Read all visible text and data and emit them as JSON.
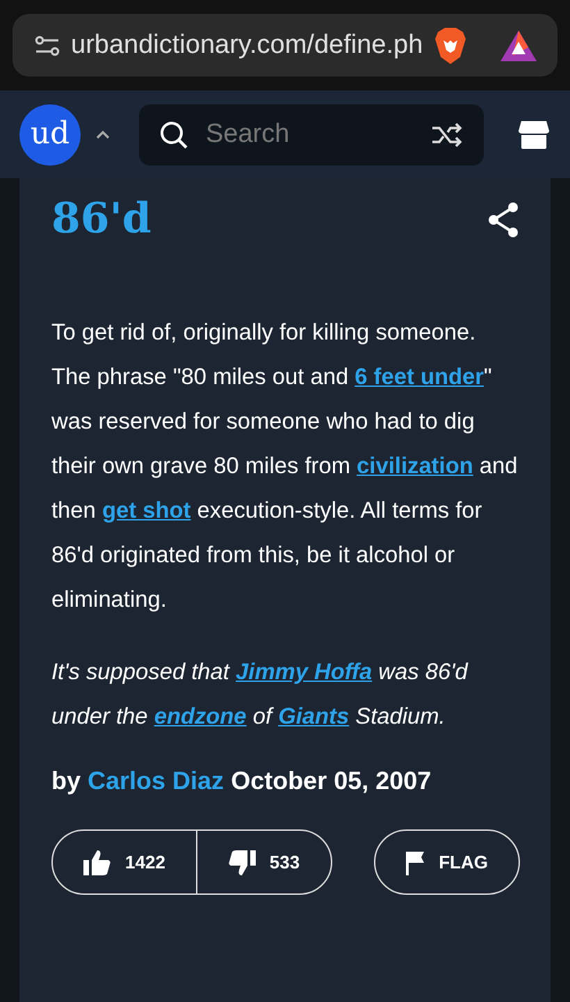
{
  "browser": {
    "url": "urbandictionary.com/define.ph"
  },
  "header": {
    "logo": "ud",
    "search": {
      "placeholder": "Search"
    }
  },
  "entry": {
    "word": "86'd",
    "meaning": [
      {
        "kind": "text",
        "text": "To get rid of, originally for killing someone. The phrase \"80 miles out and "
      },
      {
        "kind": "link",
        "text": "6 feet under"
      },
      {
        "kind": "text",
        "text": "\" was reserved for someone who had to dig their own grave 80 miles from "
      },
      {
        "kind": "link",
        "text": "civilization"
      },
      {
        "kind": "text",
        "text": " and then "
      },
      {
        "kind": "link",
        "text": "get shot"
      },
      {
        "kind": "text",
        "text": " execution-style. All terms for 86'd originated from this, be it alcohol or eliminating."
      }
    ],
    "example": [
      {
        "kind": "text",
        "text": "It's supposed that "
      },
      {
        "kind": "link",
        "text": "Jimmy Hoffa"
      },
      {
        "kind": "text",
        "text": " was 86'd under the "
      },
      {
        "kind": "link",
        "text": "endzone"
      },
      {
        "kind": "text",
        "text": " of "
      },
      {
        "kind": "link",
        "text": "Giants"
      },
      {
        "kind": "text",
        "text": " Stadium."
      }
    ],
    "byline": {
      "prefix": "by",
      "author": "Carlos Diaz",
      "date": "October 05, 2007"
    },
    "upvotes": "1422",
    "downvotes": "533",
    "flag": "FLAG"
  }
}
